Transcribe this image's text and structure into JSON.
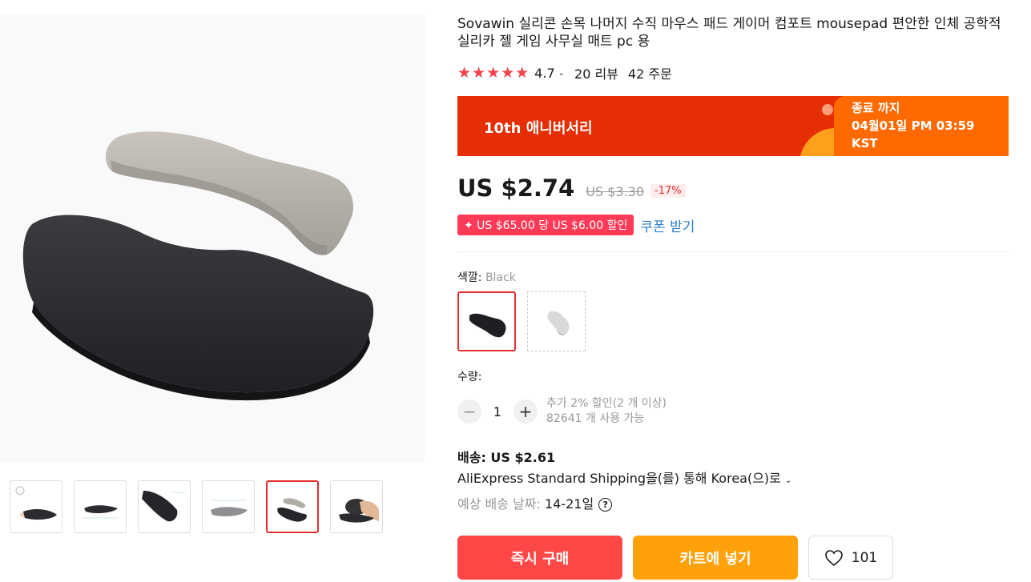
{
  "product": {
    "title": "Sovawin 실리콘 손목 나머지 수직 마우스 패드 게이머 컴포트 mousepad 편안한 인체 공학적 실리카 젤 게임 사무실 매트 pc 용",
    "stars": "★★★★★",
    "rating": "4.7",
    "reviews": "20 리뷰",
    "orders": "42 주문"
  },
  "banner": {
    "label": "10th 애니버서리",
    "timer_title": "종료 까지",
    "timer_date": "04월01일 PM 03:59",
    "timer_tz": "KST"
  },
  "price": {
    "current": "US $2.74",
    "original": "US $3.30",
    "discount": "-17%"
  },
  "coupon": {
    "tag": "✦ US $65.00 당 US $6.00 할인",
    "link": "쿠폰 받기"
  },
  "color": {
    "label": "색깔: ",
    "value": "Black"
  },
  "quantity": {
    "label": "수량:",
    "value": "1",
    "minus": "−",
    "plus": "+",
    "extra_discount": "추가 2% 할인(2 개 이상)",
    "available": "82641 개 사용 가능"
  },
  "shipping": {
    "cost": "배송: US $2.61",
    "method": "AliExpress Standard Shipping을(를) 통해 Korea(으)로",
    "eta_label": "예상 배송 날짜: ",
    "eta_value": "14-21일",
    "help": "?"
  },
  "actions": {
    "buy": "즉시 구매",
    "cart": "카트에 넣기",
    "wishlist_count": "101"
  },
  "colors": {
    "accent_red": "#ff4747",
    "accent_orange": "#ffa10a",
    "banner_red": "#e62e04",
    "star": "#f5414c",
    "link": "#2d7dcc"
  }
}
